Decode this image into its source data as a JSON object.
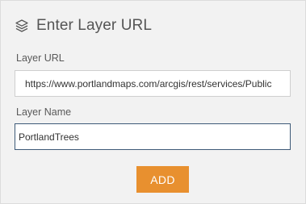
{
  "dialog": {
    "title": "Enter Layer URL",
    "header_icon": "layers-icon"
  },
  "layer_url": {
    "label": "Layer URL",
    "value": "https://www.portlandmaps.com/arcgis/rest/services/Public"
  },
  "layer_name": {
    "label": "Layer Name",
    "value": "PortlandTrees"
  },
  "actions": {
    "add_label": "ADD"
  },
  "colors": {
    "panel_background": "#f2f2f2",
    "accent_button": "#e8902f",
    "focused_border": "#3e5a78"
  }
}
